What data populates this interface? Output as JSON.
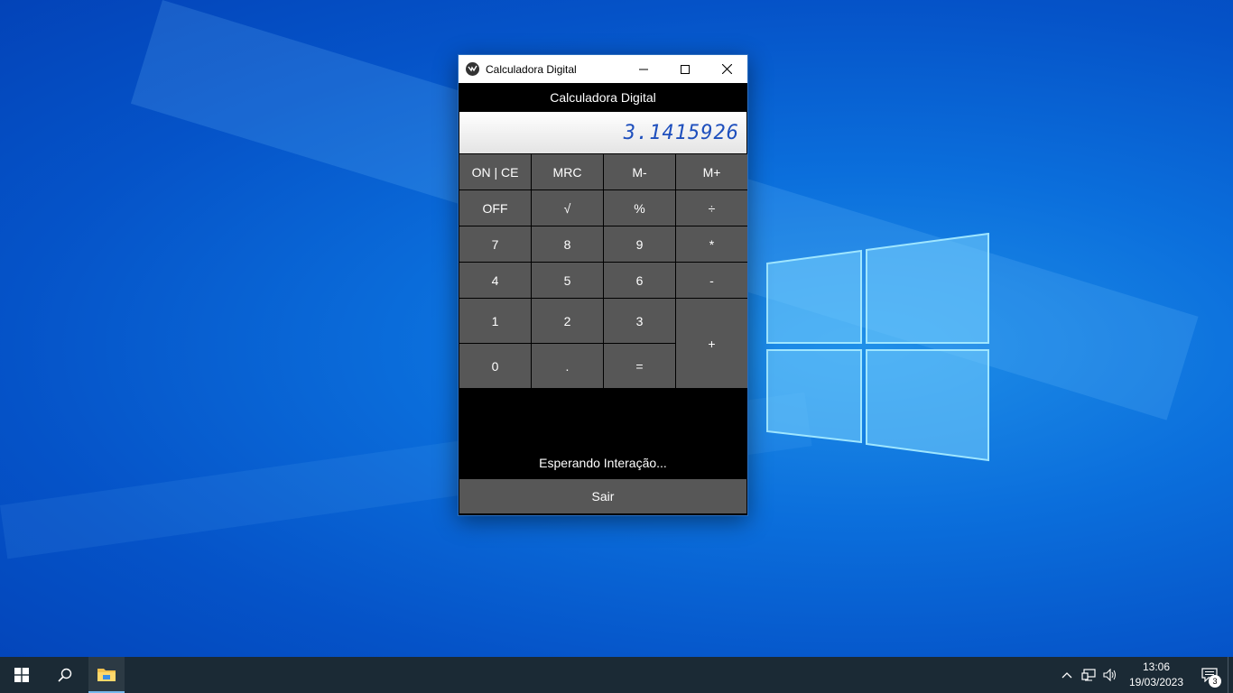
{
  "window": {
    "title": "Calculadora Digital",
    "header": "Calculadora Digital",
    "display_value": "3.1415926",
    "status": "Esperando Interação...",
    "exit_label": "Sair",
    "controls": [
      "minimize-icon",
      "maximize-icon",
      "close-icon"
    ]
  },
  "keys": [
    {
      "label": "ON | CE",
      "name": "key-on-ce"
    },
    {
      "label": "MRC",
      "name": "key-mrc"
    },
    {
      "label": "M-",
      "name": "key-m-minus"
    },
    {
      "label": "M+",
      "name": "key-m-plus"
    },
    {
      "label": "OFF",
      "name": "key-off"
    },
    {
      "label": "√",
      "name": "key-sqrt"
    },
    {
      "label": "%",
      "name": "key-percent"
    },
    {
      "label": "÷",
      "name": "key-divide"
    },
    {
      "label": "7",
      "name": "key-7"
    },
    {
      "label": "8",
      "name": "key-8"
    },
    {
      "label": "9",
      "name": "key-9"
    },
    {
      "label": "*",
      "name": "key-multiply"
    },
    {
      "label": "4",
      "name": "key-4"
    },
    {
      "label": "5",
      "name": "key-5"
    },
    {
      "label": "6",
      "name": "key-6"
    },
    {
      "label": "-",
      "name": "key-minus"
    },
    {
      "label": "1",
      "name": "key-1"
    },
    {
      "label": "2",
      "name": "key-2"
    },
    {
      "label": "3",
      "name": "key-3"
    },
    {
      "label": "+",
      "name": "key-plus"
    },
    {
      "label": "0",
      "name": "key-0"
    },
    {
      "label": ".",
      "name": "key-decimal"
    },
    {
      "label": "=",
      "name": "key-equals"
    }
  ],
  "taskbar": {
    "time": "13:06",
    "date": "19/03/2023",
    "notification_count": "3",
    "icons": [
      "windows-start-icon",
      "search-icon",
      "file-explorer-icon",
      "chevron-up-icon",
      "network-icon",
      "volume-icon",
      "action-center-icon"
    ]
  },
  "colors": {
    "display_text": "#1e4fbd",
    "key_bg": "#575757",
    "taskbar_bg": "#1b2a35"
  }
}
